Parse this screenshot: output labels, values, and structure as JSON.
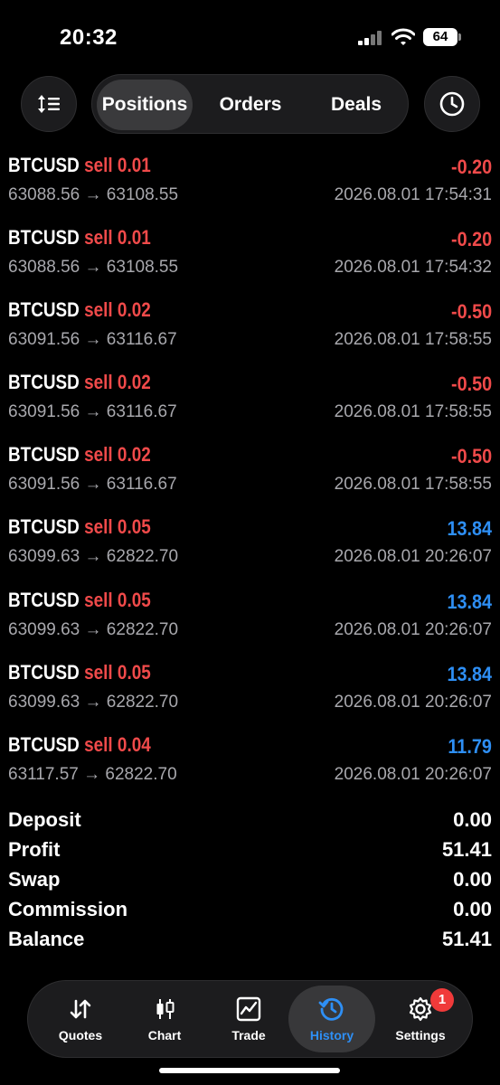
{
  "status": {
    "time": "20:32",
    "battery": "64"
  },
  "toolbar": {
    "tabs": [
      {
        "label": "Positions",
        "active": true
      },
      {
        "label": "Orders",
        "active": false
      },
      {
        "label": "Deals",
        "active": false
      }
    ],
    "sort_icon": "sort-icon",
    "history_icon": "clock-icon"
  },
  "positions": [
    {
      "symbol": "BTCUSD",
      "side": "sell 0.01",
      "pnl": "-0.20",
      "prices": "63088.56 → 63108.55",
      "time": "2026.08.01 17:54:31"
    },
    {
      "symbol": "BTCUSD",
      "side": "sell 0.01",
      "pnl": "-0.20",
      "prices": "63088.56 → 63108.55",
      "time": "2026.08.01 17:54:32"
    },
    {
      "symbol": "BTCUSD",
      "side": "sell 0.02",
      "pnl": "-0.50",
      "prices": "63091.56 → 63116.67",
      "time": "2026.08.01 17:58:55"
    },
    {
      "symbol": "BTCUSD",
      "side": "sell 0.02",
      "pnl": "-0.50",
      "prices": "63091.56 → 63116.67",
      "time": "2026.08.01 17:58:55"
    },
    {
      "symbol": "BTCUSD",
      "side": "sell 0.02",
      "pnl": "-0.50",
      "prices": "63091.56 → 63116.67",
      "time": "2026.08.01 17:58:55"
    },
    {
      "symbol": "BTCUSD",
      "side": "sell 0.05",
      "pnl": "13.84",
      "prices": "63099.63 → 62822.70",
      "time": "2026.08.01 20:26:07"
    },
    {
      "symbol": "BTCUSD",
      "side": "sell 0.05",
      "pnl": "13.84",
      "prices": "63099.63 → 62822.70",
      "time": "2026.08.01 20:26:07"
    },
    {
      "symbol": "BTCUSD",
      "side": "sell 0.05",
      "pnl": "13.84",
      "prices": "63099.63 → 62822.70",
      "time": "2026.08.01 20:26:07"
    },
    {
      "symbol": "BTCUSD",
      "side": "sell 0.04",
      "pnl": "11.79",
      "prices": "63117.57 → 62822.70",
      "time": "2026.08.01 20:26:07"
    }
  ],
  "summary": [
    {
      "label": "Deposit",
      "value": "0.00"
    },
    {
      "label": "Profit",
      "value": "51.41"
    },
    {
      "label": "Swap",
      "value": "0.00"
    },
    {
      "label": "Commission",
      "value": "0.00"
    },
    {
      "label": "Balance",
      "value": "51.41"
    }
  ],
  "tabbar": {
    "items": [
      {
        "label": "Quotes",
        "icon": "quotes-arrows-icon"
      },
      {
        "label": "Chart",
        "icon": "candlestick-chart-icon"
      },
      {
        "label": "Trade",
        "icon": "trade-chart-icon"
      },
      {
        "label": "History",
        "icon": "history-clock-icon",
        "active": true
      },
      {
        "label": "Settings",
        "icon": "gear-icon"
      }
    ],
    "settings_badge": "1"
  },
  "colors": {
    "loss": "#f04a4a",
    "profit": "#2e8ff5",
    "background": "#000000"
  }
}
